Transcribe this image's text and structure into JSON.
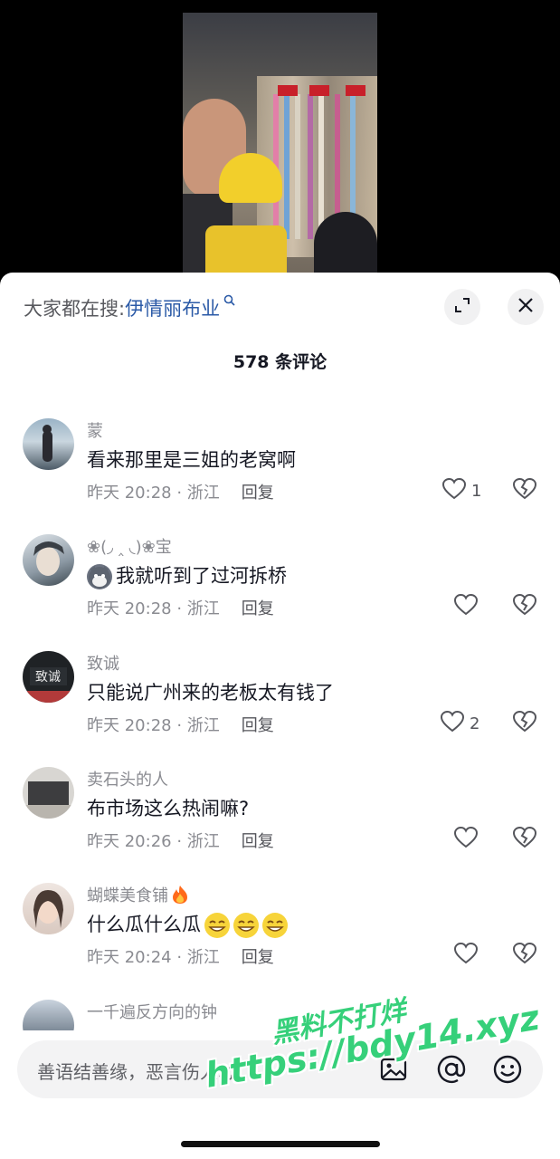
{
  "search": {
    "prefix": "大家都在搜:",
    "keyword": "伊情丽布业"
  },
  "comment_count_title": "578 条评论",
  "comments": [
    {
      "name": "蒙",
      "text": "看来那里是三姐的老窝啊",
      "time": "昨天 20:28 · 浙江",
      "reply": "回复",
      "likes": "1",
      "prefix_emoji": "",
      "suffix_emojis": ""
    },
    {
      "name": "❀(◞ ‸ ◟)❀宝",
      "text": "我就听到了过河拆桥",
      "time": "昨天 20:28 · 浙江",
      "reply": "回复",
      "likes": "",
      "prefix_emoji": "dog-face-emoji",
      "suffix_emojis": ""
    },
    {
      "name": "致诚",
      "text": "只能说广州来的老板太有钱了",
      "time": "昨天 20:28 · 浙江",
      "reply": "回复",
      "likes": "2",
      "prefix_emoji": "",
      "suffix_emojis": ""
    },
    {
      "name": "卖石头的人",
      "text": "布市场这么热闹嘛?",
      "time": "昨天 20:26 · 浙江",
      "reply": "回复",
      "likes": "",
      "prefix_emoji": "",
      "suffix_emojis": ""
    },
    {
      "name": "蝴蝶美食铺",
      "text": "什么瓜什么瓜",
      "time": "昨天 20:24 · 浙江",
      "reply": "回复",
      "likes": "",
      "prefix_emoji": "",
      "suffix_emojis": "grin-emoji x3"
    },
    {
      "name": "一千遍反方向的钟",
      "text": "",
      "time": "",
      "reply": "",
      "likes": ""
    }
  ],
  "input": {
    "placeholder": "善语结善缘，恶言伤人心"
  },
  "watermark": {
    "line1": "黑料不打烊",
    "line2": "https://bdy14.xyz"
  },
  "icons": {
    "expand": "expand-icon",
    "close": "close-icon",
    "image": "image-icon",
    "mention": "at-icon",
    "emoji": "emoji-icon",
    "like": "heart-icon",
    "dislike": "broken-heart-icon"
  },
  "colors": {
    "keyword": "#2b5aa7",
    "watermark": "#36d07a",
    "meta": "#8a8b91"
  }
}
